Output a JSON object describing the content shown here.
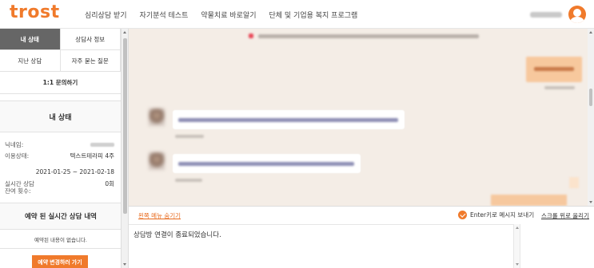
{
  "header": {
    "logo": "trost",
    "nav": [
      "심리상담 받기",
      "자기분석 테스트",
      "약물치료 바로알기",
      "단체 및 기업용 복지 프로그램"
    ],
    "avatar_icon": "user-avatar-icon"
  },
  "sidebar": {
    "tabs": [
      {
        "label": "내 상태",
        "active": true
      },
      {
        "label": "상담사 정보",
        "active": false
      },
      {
        "label": "지난 상담",
        "active": false
      },
      {
        "label": "자주 묻는 질문",
        "active": false
      }
    ],
    "inquiry_label": "1:1 문의하기",
    "status_title": "내 상태",
    "info": {
      "nickname_label": "닉네임:",
      "usage_label": "이용상태:",
      "usage_value": "텍스트테라피 4주",
      "period_value": "2021-01-25 ~ 2021-02-18",
      "remaining_label_1": "실시간 상담",
      "remaining_label_2": "잔여 횟수:",
      "remaining_value": "0회"
    },
    "reservation_title": "예약 된 실시간 상담 내역",
    "reservation_empty": "예약된 내용이 없습니다.",
    "reservation_button": "예약 변경하러 가기"
  },
  "chat_controls": {
    "hide_menu": "왼쪽 메뉴 숨기기",
    "enter_option": "Enter키로 메시지 보내기",
    "scroll_top": "스크롤 위로 올리기"
  },
  "message_input": {
    "value": "상담방 연결이 종료되었습니다."
  },
  "colors": {
    "accent": "#f07a2b",
    "chat_background": "#f4ede6",
    "active_tab": "#666666"
  }
}
